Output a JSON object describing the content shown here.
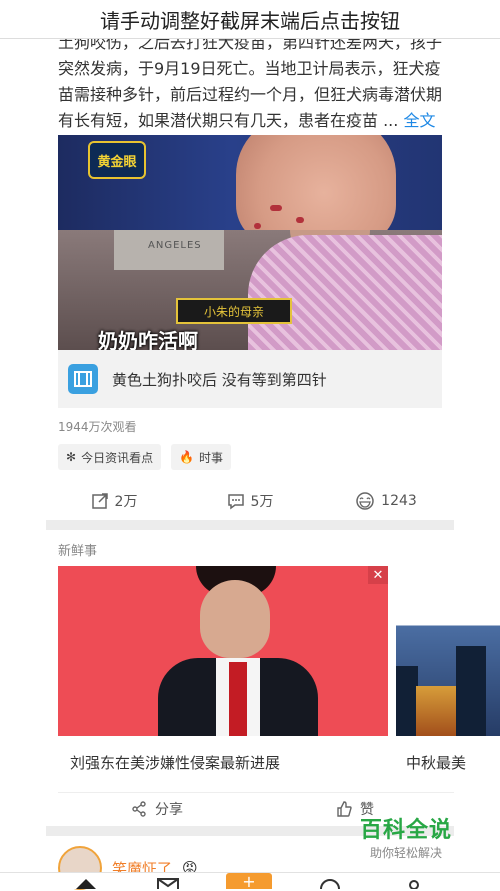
{
  "overlay": {
    "text": "请手动调整好截屏末端后点击按钮"
  },
  "post": {
    "text": "土狗咬伤，之后去打狂犬疫苗，第四针还差两天，孩子突然发病，于9月19日死亡。当地卫计局表示，狂犬疫苗需接种多针，前后过程约一个月，但狂犬病毒潜伏期有长有短，如果潜伏期只有几天，患者在疫苗 ...",
    "more": "全文"
  },
  "video": {
    "logo": "黄金眼",
    "shirt_text": "ANGELES",
    "caption_tag": "小朱的母亲",
    "subtitle": "奶奶咋活啊",
    "title": "黄色土狗扑咬后  没有等到第四针"
  },
  "views": "1944万次观看",
  "chips": {
    "c1": "今日资讯看点",
    "c2": "时事"
  },
  "actions": {
    "share": "2万",
    "comment": "5万",
    "like": "1243"
  },
  "fresh": {
    "label": "新鲜事",
    "card1_title": "刘强东在美涉嫌性侵案最新进展",
    "card2_title": "中秋最美",
    "share": "分享",
    "like": "赞",
    "close": "✕"
  },
  "user": {
    "name": "笑魔怔了"
  },
  "watermark": {
    "big": "百科全说",
    "small": "助你轻松解决"
  },
  "colors": {
    "accent": "#f07e28",
    "link": "#1e88e5",
    "watermark": "#28a745"
  }
}
